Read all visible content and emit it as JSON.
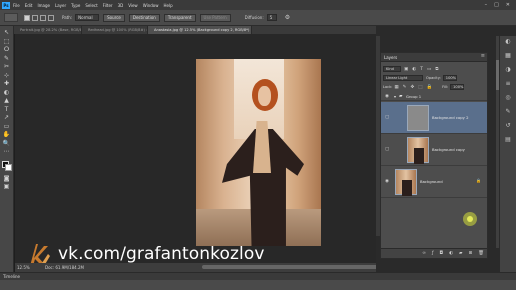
{
  "menubar": {
    "app_badge": "Ps",
    "items": [
      "File",
      "Edit",
      "Image",
      "Layer",
      "Type",
      "Select",
      "Filter",
      "3D",
      "View",
      "Window",
      "Help"
    ],
    "window_controls": [
      "–",
      "□",
      "✕"
    ]
  },
  "options": {
    "path_label": "Path:",
    "path_value": "Normal",
    "source": "Source",
    "destination": "Destination",
    "transparent": "Transparent",
    "use_pattern": "Use Pattern",
    "diffusion_label": "Diffusion:",
    "diffusion_value": "5"
  },
  "tabs": [
    {
      "label": "Portrait.jpg @ 28.2% (Base, RGB/8*) ×",
      "active": false
    },
    {
      "label": "Redhead.jpg @ 100% (RGB/8#) ×",
      "active": false
    },
    {
      "label": "Anastasia.jpg @ 12.5% (Background copy 2, RGB/8*) ×",
      "active": true
    }
  ],
  "tools": [
    "↖",
    "⬚",
    "ⵔ",
    "✎",
    "✂",
    "⊹",
    "✚",
    "◐",
    "▲",
    "T",
    "↗",
    "▭",
    "✋",
    "🔍",
    "⋯"
  ],
  "watermark": {
    "text": "vk.com/grafantonkozlov"
  },
  "status": {
    "zoom": "12.5%",
    "doc": "Doc: 61.9M/184.2M"
  },
  "timeline": {
    "label": "Timeline"
  },
  "layers_panel": {
    "title": "Layers",
    "kind_label": "Kind",
    "blend_mode": "Linear Light",
    "opacity_label": "Opacity:",
    "opacity_value": "100%",
    "lock_label": "Lock:",
    "fill_label": "Fill:",
    "fill_value": "100%",
    "group_name": "Group 1",
    "layers": [
      {
        "name": "Background copy 2",
        "selected": true,
        "visible": false
      },
      {
        "name": "Background copy",
        "selected": false,
        "visible": false
      },
      {
        "name": "Background",
        "selected": false,
        "visible": true
      }
    ],
    "footer_icons": [
      "link-icon",
      "fx-icon",
      "mask-icon",
      "adjustment-icon",
      "folder-icon",
      "new-layer-icon",
      "trash-icon"
    ]
  },
  "colors": {
    "accent_blue": "#31a8ff",
    "selected_layer": "#5a6f8c",
    "cursor_highlight": "#e4ea5a"
  }
}
